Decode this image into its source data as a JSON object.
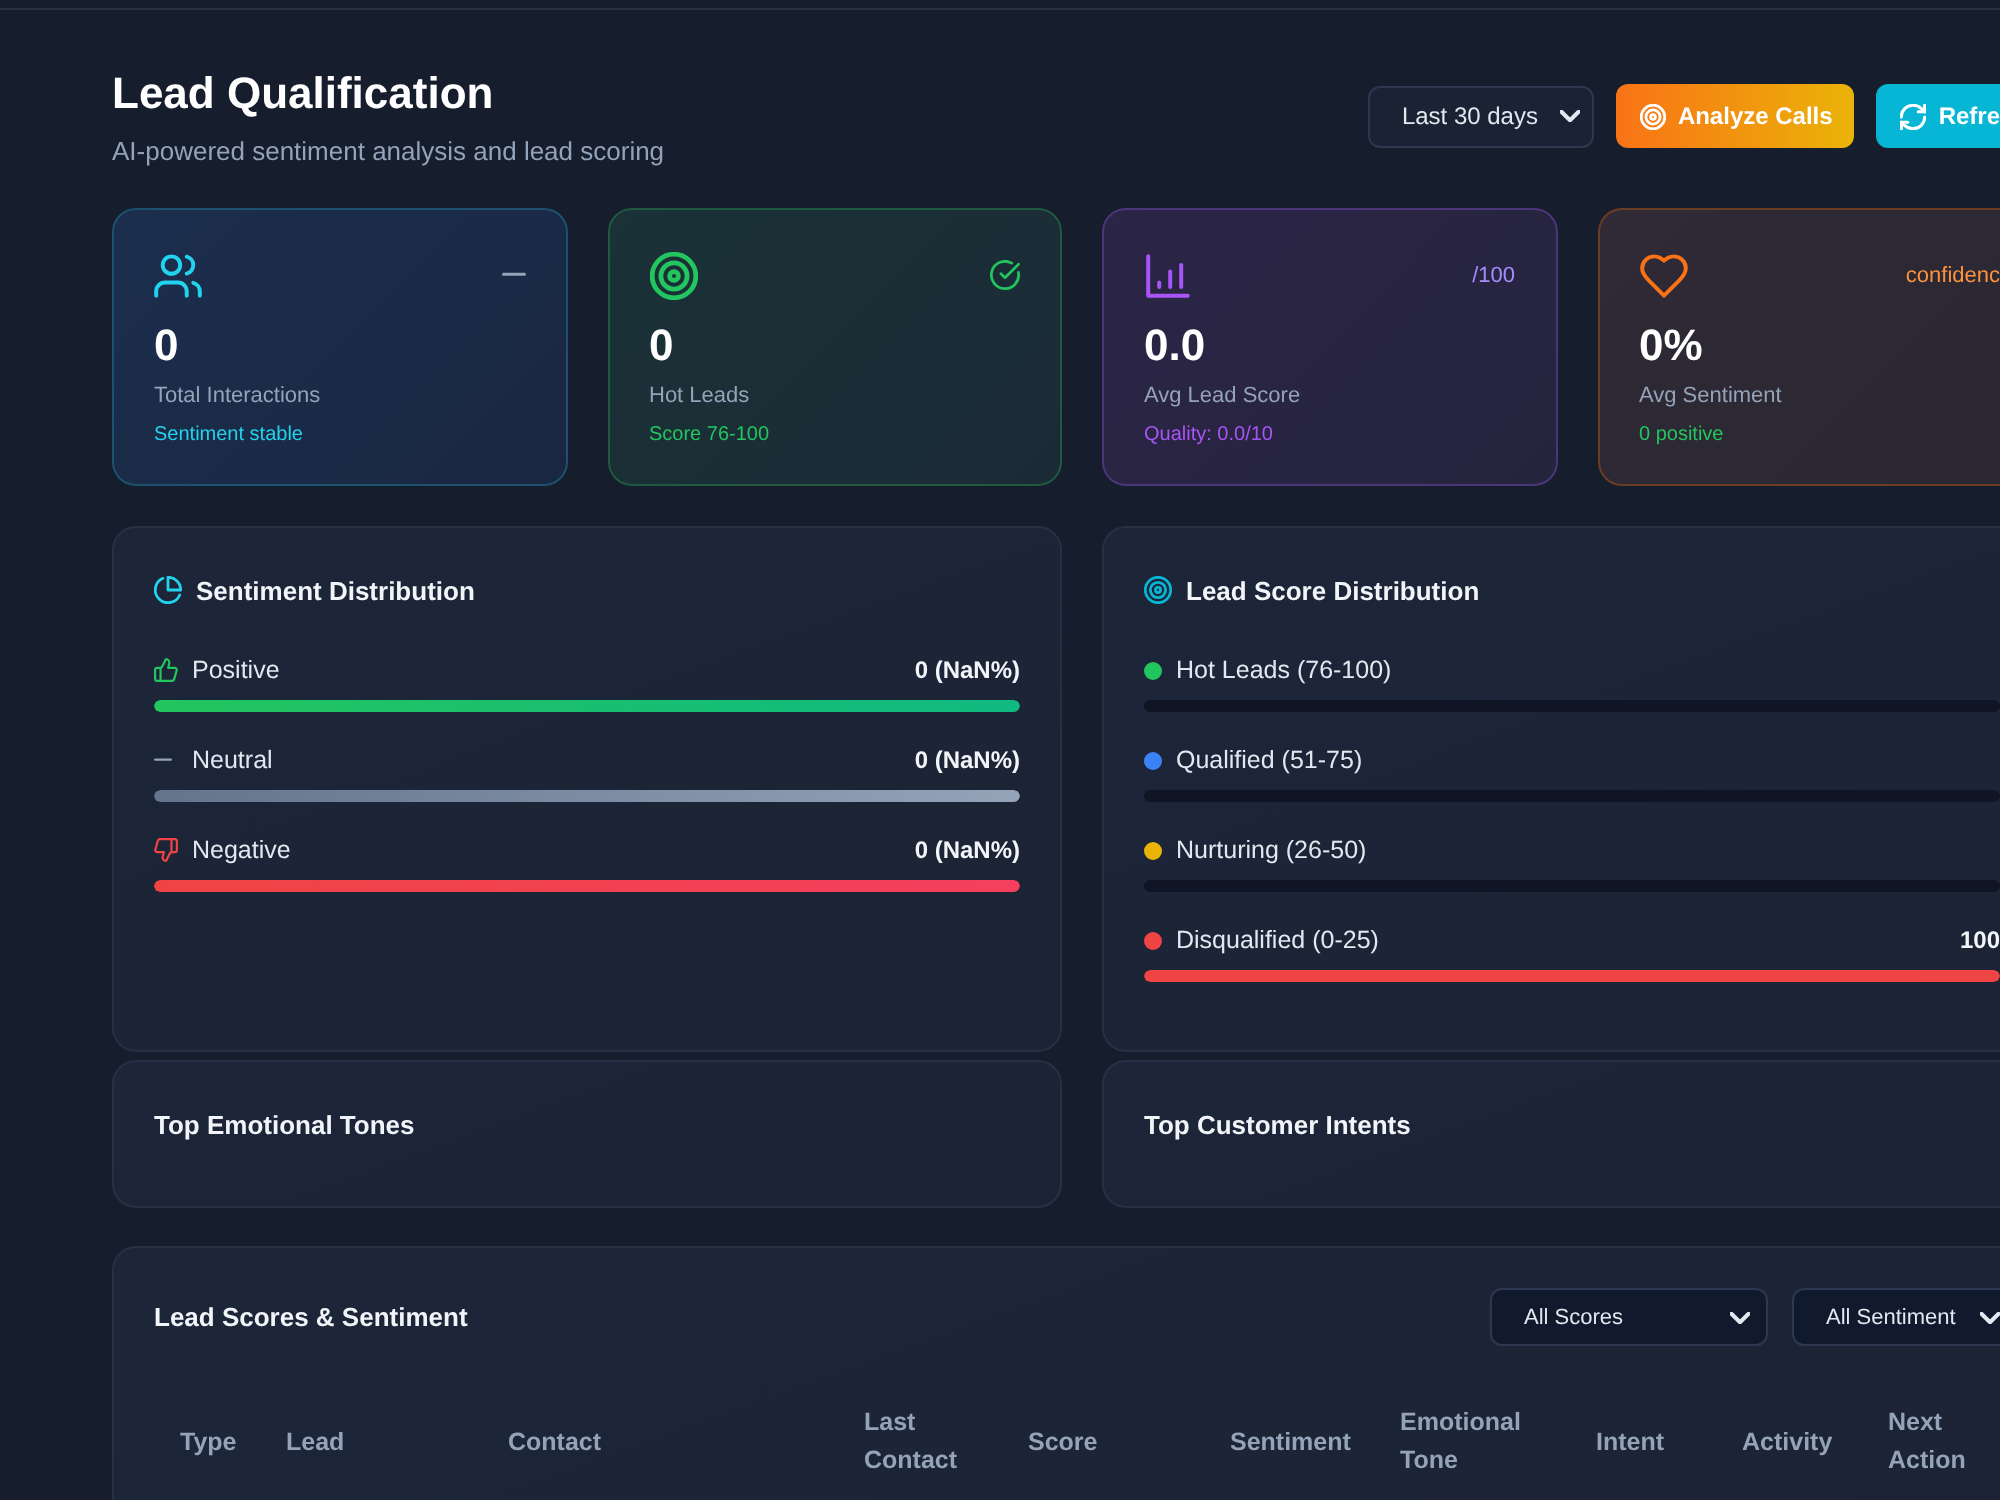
{
  "header": {
    "title": "Lead Qualification",
    "subtitle": "AI-powered sentiment analysis and lead scoring",
    "period": {
      "value": "Last 30 days"
    },
    "buttons": [
      {
        "kind": "analyze",
        "label": "Analyze Calls"
      },
      {
        "kind": "refresh",
        "label": "Refre"
      }
    ]
  },
  "stats": [
    {
      "kind": "users",
      "value": "0",
      "label": "Total Interactions",
      "note": "Sentiment stable",
      "corner": {
        "kind": "dash"
      }
    },
    {
      "kind": "target",
      "value": "0",
      "label": "Hot Leads",
      "note": "Score 76-100",
      "corner": {
        "kind": "check"
      }
    },
    {
      "kind": "chart",
      "value": "0.0",
      "label": "Avg Lead Score",
      "note": "Quality: 0.0/10",
      "corner": {
        "kind": "text",
        "text": "/100"
      }
    },
    {
      "kind": "heart",
      "value": "0%",
      "label": "Avg Sentiment",
      "note": "0 positive",
      "corner": {
        "kind": "text",
        "text": "confidenc"
      }
    }
  ],
  "sentiment_distribution": {
    "title": "Sentiment Distribution",
    "items": [
      {
        "kind": "positive",
        "label": "Positive",
        "value": "0 (NaN%)",
        "level": 1
      },
      {
        "kind": "neutral",
        "label": "Neutral",
        "value": "0 (NaN%)",
        "level": 1
      },
      {
        "kind": "negative",
        "label": "Negative",
        "value": "0 (NaN%)",
        "level": 1
      }
    ]
  },
  "lead_score_distribution": {
    "title": "Lead Score Distribution",
    "items": [
      {
        "label": "Hot Leads (76-100)",
        "color": "#22c55e",
        "level": 0
      },
      {
        "label": "Qualified (51-75)",
        "color": "#3b82f6",
        "level": 0
      },
      {
        "label": "Nurturing (26-50)",
        "color": "#eab308",
        "level": 0
      },
      {
        "label": "Disqualified (0-25)",
        "color": "#ef4444",
        "value": "100",
        "level": 1
      }
    ]
  },
  "top_emotional_tones": {
    "title": "Top Emotional Tones"
  },
  "top_customer_intents": {
    "title": "Top Customer Intents"
  },
  "lead_table": {
    "title": "Lead Scores & Sentiment",
    "filters": [
      {
        "value": "All Scores"
      },
      {
        "value": "All Sentiment"
      }
    ],
    "columns": [
      "Type",
      "Lead",
      "Contact",
      "Last Contact",
      "Score",
      "Sentiment",
      "Emotional Tone",
      "Intent",
      "Activity",
      "Next Action"
    ]
  }
}
